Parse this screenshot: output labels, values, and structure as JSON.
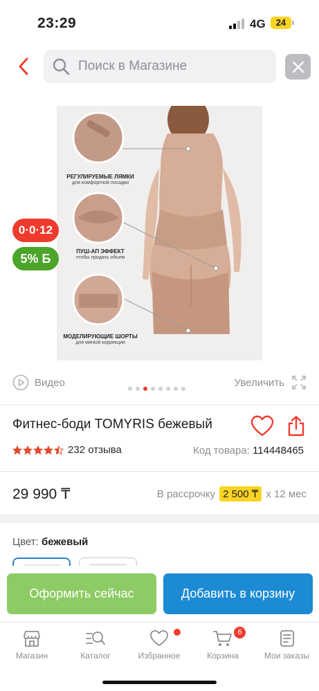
{
  "status_bar": {
    "time": "23:29",
    "network": "4G",
    "battery": "24"
  },
  "search": {
    "placeholder": "Поиск в Магазине"
  },
  "image": {
    "callouts": [
      {
        "title": "РЕГУЛИРУЕМЫЕ ЛЯМКИ",
        "subtitle": "для комфортной посадки"
      },
      {
        "title": "ПУШ-АП ЭФФЕКТ",
        "subtitle": "чтобы придать объем"
      },
      {
        "title": "МОДЕЛИРУЮЩИЕ ШОРТЫ",
        "subtitle": "для мягкой коррекции"
      }
    ]
  },
  "badges": {
    "installment": "0·0·12",
    "bonus": "5% Б"
  },
  "media": {
    "video_label": "Видео",
    "zoom_label": "Увеличить",
    "dots_count": 8,
    "active_dot": 3
  },
  "product": {
    "title": "Фитнес-боди TOMYRIS бежевый",
    "rating": 4.5,
    "reviews": "232 отзыва",
    "sku_label": "Код товара:",
    "sku": "114448465",
    "price": "29 990 ₸",
    "installment_prefix": "В рассрочку",
    "installment_amount": "2 500 ₸",
    "installment_suffix": "х 12 мес"
  },
  "color": {
    "label": "Цвет:",
    "value": "бежевый"
  },
  "actions": {
    "buy_now": "Оформить сейчас",
    "add_to_cart": "Добавить в корзину"
  },
  "tabs": [
    {
      "label": "Магазин",
      "icon": "store-icon"
    },
    {
      "label": "Каталог",
      "icon": "catalog-search-icon"
    },
    {
      "label": "Избранное",
      "icon": "heart-icon"
    },
    {
      "label": "Корзина",
      "icon": "cart-icon",
      "badge": "6"
    },
    {
      "label": "Мои заказы",
      "icon": "orders-icon"
    }
  ],
  "colors": {
    "accent_red": "#ef3b2d",
    "buy_green": "#8dcb64",
    "cart_blue": "#1c8bd3",
    "installment_yellow": "#f9d423"
  }
}
